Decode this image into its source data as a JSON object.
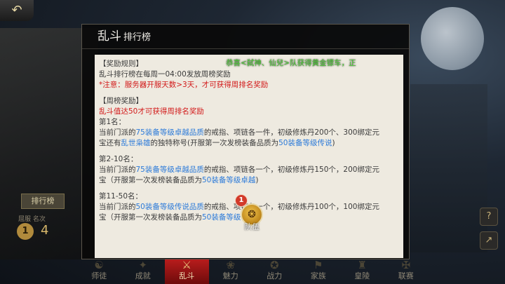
{
  "back_icon": "back-arrow-icon",
  "sidebar": {
    "rank_tab": "排行榜",
    "rank_header": "屈服  名次",
    "rank_medal": "1",
    "rank_value": "4"
  },
  "side_buttons": [
    "help-icon",
    "share-icon"
  ],
  "side_button_glyphs": [
    "?",
    "↗"
  ],
  "dialog": {
    "title_main": "乱斗",
    "title_sub": "排行榜"
  },
  "broadcast": "恭喜<弑神、仙兒>队获得黄金镖车，正",
  "content": {
    "section_rules": "【奖励规则】",
    "rules_line": "乱斗排行榜在每周一04:00发放周榜奖励",
    "rules_note": "*注意：服务器开服天数>3天，才可获得周排名奖励",
    "section_weekly": "【周榜奖励】",
    "weekly_requirement": "乱斗值达50才可获得周排名奖励",
    "rank1": {
      "title": "第1名：",
      "l1a": "当前门派的",
      "l1b": "75装备等级卓越品质",
      "l1c": "的戒指、项链各一件，初级修炼丹200个、300绑定元",
      "l2a": "宝还有",
      "l2b": "乱世枭雄",
      "l2c": "的独特称号(开服第一次发榜装备品质为",
      "l2d": "50装备等级传说",
      "l2e": ")"
    },
    "rank2": {
      "title": "第2-10名：",
      "l1a": "当前门派的",
      "l1b": "75装备等级卓越品质",
      "l1c": "的戒指、项链各一个，初级修炼丹150个，200绑定元",
      "l2a": "宝（开服第一次发榜装备品质为",
      "l2b": "50装备等级卓越",
      "l2c": ")"
    },
    "rank3": {
      "title": "第11-50名：",
      "l1a": "当前门派的",
      "l1b": "50装备等级传说品质",
      "l1c": "的戒指、项链各一个，初级修炼丹100个，100绑定元",
      "l2a": "宝（开服第一次发榜装备品质为",
      "l2b": "50装备等级"
    }
  },
  "team": {
    "badge": "1",
    "label": "队伍",
    "icon": "team-paw-icon"
  },
  "bottom_nav": [
    {
      "label": "师徒",
      "icon": "master-icon",
      "glyph": "☯"
    },
    {
      "label": "成就",
      "icon": "achievement-icon",
      "glyph": "✦"
    },
    {
      "label": "乱斗",
      "icon": "brawl-icon",
      "glyph": "⚔",
      "active": true
    },
    {
      "label": "魅力",
      "icon": "charm-icon",
      "glyph": "❀"
    },
    {
      "label": "战力",
      "icon": "power-icon",
      "glyph": "✪"
    },
    {
      "label": "家族",
      "icon": "clan-icon",
      "glyph": "⚑"
    },
    {
      "label": "皇陵",
      "icon": "tomb-icon",
      "glyph": "♜"
    },
    {
      "label": "联赛",
      "icon": "league-icon",
      "glyph": "✠"
    }
  ],
  "colors": {
    "highlight_red": "#d21919",
    "highlight_blue": "#2b7ad9",
    "broadcast_green": "#48c832",
    "active_tab": "#b71c1c"
  }
}
